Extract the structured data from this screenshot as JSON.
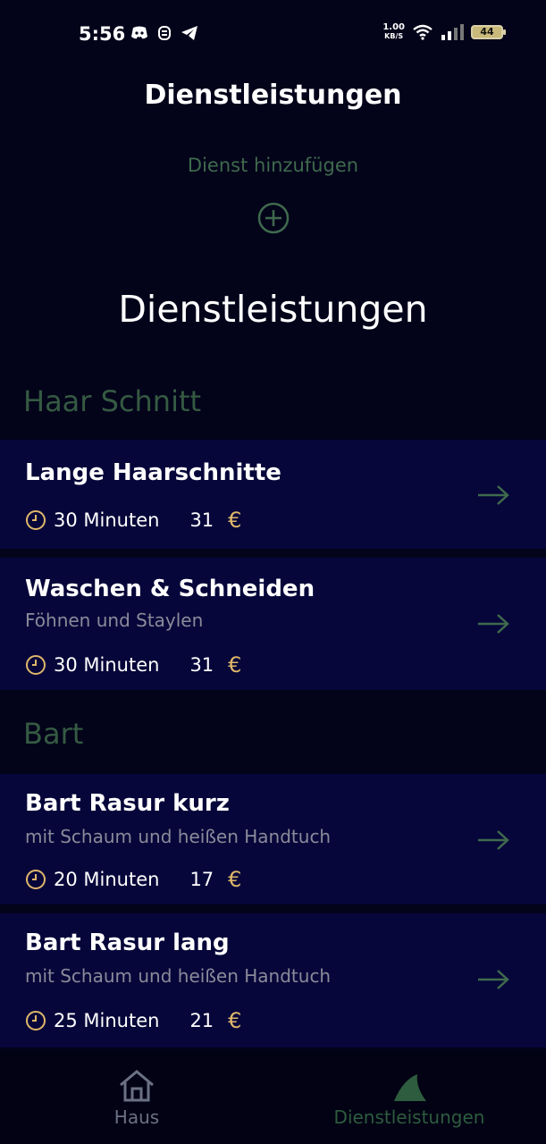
{
  "status": {
    "time": "5:56",
    "speed_value": "1.00",
    "speed_unit": "KB/S",
    "battery": "44"
  },
  "header": {
    "title": "Dienstleistungen",
    "add_label": "Dienst hinzufügen"
  },
  "main": {
    "section_title": "Dienstleistungen",
    "categories": [
      {
        "name": "Haar Schnitt",
        "services": [
          {
            "title": "Lange Haarschnitte",
            "subtitle": "",
            "duration": "30 Minuten",
            "price": "31",
            "currency": "€"
          },
          {
            "title": "Waschen & Schneiden",
            "subtitle": "Föhnen und Staylen",
            "duration": "30 Minuten",
            "price": "31",
            "currency": "€"
          }
        ]
      },
      {
        "name": "Bart",
        "services": [
          {
            "title": "Bart Rasur kurz",
            "subtitle": "mit Schaum und heißen Handtuch",
            "duration": "20 Minuten",
            "price": "17",
            "currency": "€"
          },
          {
            "title": "Bart Rasur lang",
            "subtitle": "mit Schaum und heißen Handtuch",
            "duration": "25 Minuten",
            "price": "21",
            "currency": "€"
          }
        ]
      }
    ]
  },
  "bottom_nav": {
    "home_label": "Haus",
    "services_label": "Dienstleistungen"
  },
  "colors": {
    "background": "#03031a",
    "card": "#06063a",
    "accent_green": "#3f6a4d",
    "euro_gold": "#e0b76a"
  }
}
